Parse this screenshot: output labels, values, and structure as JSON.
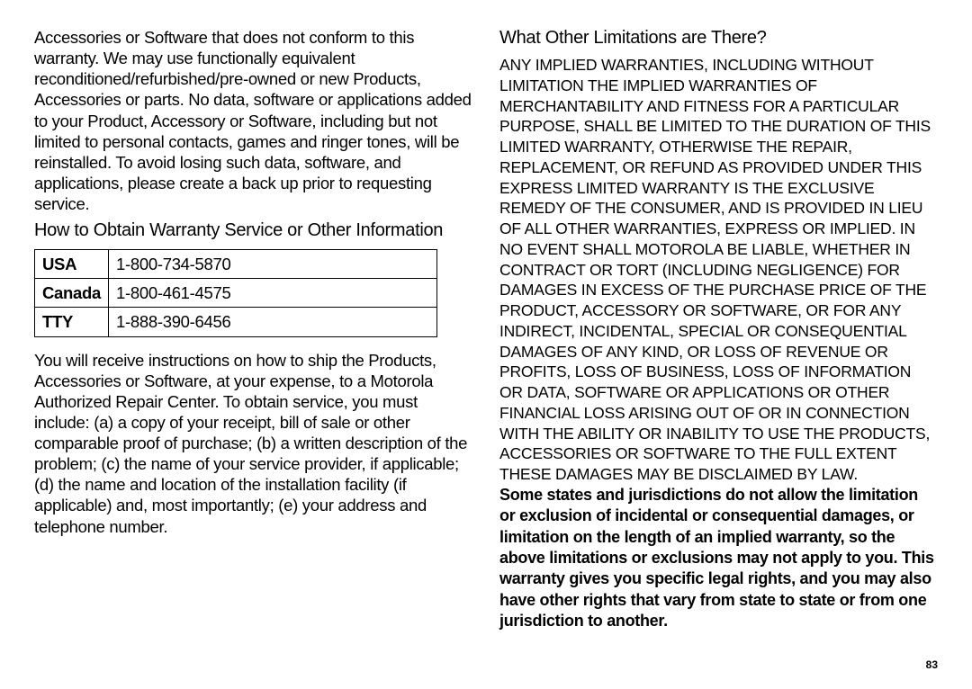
{
  "leftColumn": {
    "intro": "Accessories or Software that does not conform to this warranty. We may use functionally equivalent reconditioned/refurbished/pre-owned or new Products, Accessories or parts. No data, software or applications added to your Product, Accessory or Software, including but not limited to personal contacts, games and ringer tones, will be reinstalled. To avoid losing such data, software, and applications, please create a back up prior to requesting service.",
    "heading": "How to Obtain Warranty Service or Other Information",
    "phoneRows": [
      {
        "label": "USA",
        "value": "1-800-734-5870"
      },
      {
        "label": "Canada",
        "value": "1-800-461-4575"
      },
      {
        "label": "TTY",
        "value": "1-888-390-6456"
      }
    ],
    "after": "You will receive instructions on how to ship the Products, Accessories or Software, at your expense, to a Motorola Authorized Repair Center. To obtain service, you must include: (a) a copy of your receipt, bill of sale or other comparable proof of purchase; (b) a written description of the problem; (c) the name of your service provider, if applicable; (d) the name and location of the installation facility (if applicable) and, most importantly; (e) your address and telephone number."
  },
  "rightColumn": {
    "heading": "What Other Limitations are There?",
    "caps": "ANY IMPLIED WARRANTIES, INCLUDING WITHOUT LIMITATION THE IMPLIED WARRANTIES OF MERCHANTABILITY AND FITNESS FOR A PARTICULAR PURPOSE, SHALL BE LIMITED TO THE DURATION OF THIS LIMITED WARRANTY, OTHERWISE THE REPAIR, REPLACEMENT, OR REFUND AS PROVIDED UNDER THIS EXPRESS LIMITED WARRANTY IS THE EXCLUSIVE REMEDY OF THE CONSUMER, AND IS PROVIDED IN LIEU OF ALL OTHER WARRANTIES, EXPRESS OR IMPLIED. IN NO EVENT SHALL MOTOROLA BE LIABLE, WHETHER IN CONTRACT OR TORT (INCLUDING NEGLIGENCE) FOR DAMAGES IN EXCESS OF THE PURCHASE PRICE OF THE PRODUCT, ACCESSORY OR SOFTWARE, OR FOR ANY INDIRECT, INCIDENTAL, SPECIAL OR CONSEQUENTIAL DAMAGES OF ANY KIND, OR LOSS OF REVENUE OR PROFITS, LOSS OF BUSINESS, LOSS OF INFORMATION OR DATA, SOFTWARE OR APPLICATIONS OR OTHER FINANCIAL LOSS ARISING OUT OF OR IN CONNECTION WITH THE ABILITY OR INABILITY TO USE THE PRODUCTS, ACCESSORIES OR SOFTWARE TO THE FULL EXTENT THESE DAMAGES MAY BE DISCLAIMED BY LAW.",
    "bold": "Some states and jurisdictions do not allow the limitation or exclusion of incidental or consequential damages, or limitation on the length of an implied warranty, so the above limitations or exclusions may not apply to you. This warranty gives you specific legal rights, and you may also have other rights that vary from state to state or from one jurisdiction to another."
  },
  "pageNumber": "83"
}
